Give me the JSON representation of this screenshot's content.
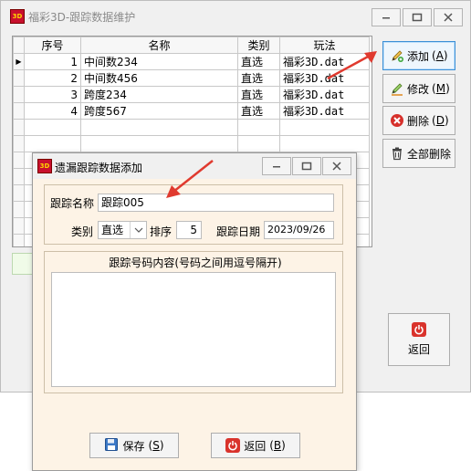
{
  "main_window": {
    "title": "福彩3D-跟踪数据维护",
    "icon_text": "3D",
    "grid": {
      "columns": [
        "序号",
        "名称",
        "类别",
        "玩法"
      ],
      "rows": [
        {
          "no": "1",
          "name": "中间数234",
          "type": "直选",
          "play": "福彩3D.dat"
        },
        {
          "no": "2",
          "name": "中间数456",
          "type": "直选",
          "play": "福彩3D.dat"
        },
        {
          "no": "3",
          "name": "跨度234",
          "type": "直选",
          "play": "福彩3D.dat"
        },
        {
          "no": "4",
          "name": "跨度567",
          "type": "直选",
          "play": "福彩3D.dat"
        }
      ],
      "current_row_marker": "▶"
    },
    "buttons": {
      "add": {
        "text": "添加",
        "key": "A"
      },
      "edit": {
        "text": "修改",
        "key": "M"
      },
      "delete": {
        "text": "删除",
        "key": "D"
      },
      "delete_all": {
        "text": "全部删除"
      },
      "return": {
        "text": "返回"
      }
    }
  },
  "dialog": {
    "title": "遗漏跟踪数据添加",
    "icon_text": "3D",
    "name_label": "跟踪名称",
    "name_value": "跟踪005",
    "type_label": "类别",
    "type_value": "直选",
    "order_label": "排序",
    "order_value": "5",
    "date_label": "跟踪日期",
    "date_value": "2023/09/26",
    "content_label": "跟踪号码内容(号码之间用逗号隔开)",
    "content_value": "",
    "save": {
      "text": "保存",
      "key": "S"
    },
    "back": {
      "text": "返回",
      "key": "B"
    }
  },
  "colors": {
    "annotation_arrow": "#e03a2f",
    "dialog_bg": "#fdf3e6",
    "primary_border": "#3c8fd6"
  }
}
